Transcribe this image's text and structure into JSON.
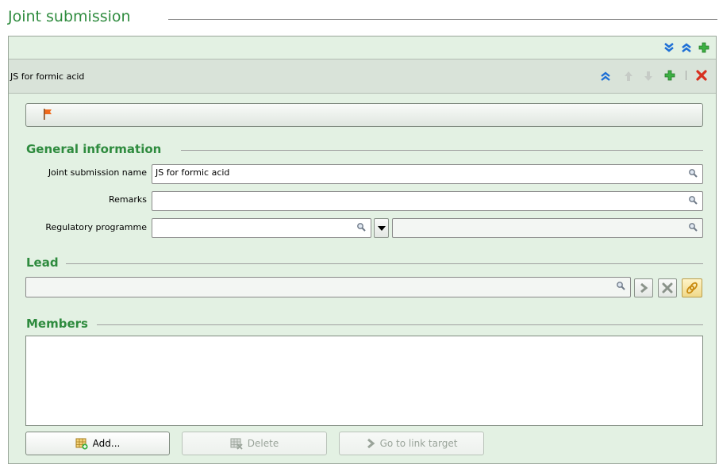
{
  "panel": {
    "title": "Joint submission"
  },
  "record": {
    "title": "JS for formic acid"
  },
  "general": {
    "heading": "General information",
    "name_label": "Joint submission name",
    "name_value": "JS for formic acid",
    "remarks_label": "Remarks",
    "remarks_value": "",
    "regprog_label": "Regulatory programme",
    "regprog_value": "",
    "regprog_other": ""
  },
  "lead": {
    "heading": "Lead",
    "value": ""
  },
  "members": {
    "heading": "Members",
    "add_label": "Add...",
    "delete_label": "Delete",
    "goto_label": "Go to link target"
  },
  "colors": {
    "accent_green": "#2e8b3e",
    "panel_bg": "#e3f1e3",
    "header_bg": "#d9e3d9",
    "delete_red": "#d7301f",
    "nav_blue": "#1d6fd6"
  },
  "icons": [
    "expand-all-icon",
    "collapse-all-icon",
    "add-icon",
    "collapse-icon",
    "move-up-icon",
    "move-down-icon",
    "delete-icon",
    "flag-icon",
    "search-icon",
    "dropdown-icon",
    "goto-icon",
    "clear-icon",
    "link-icon",
    "add-table-icon",
    "delete-table-icon"
  ]
}
